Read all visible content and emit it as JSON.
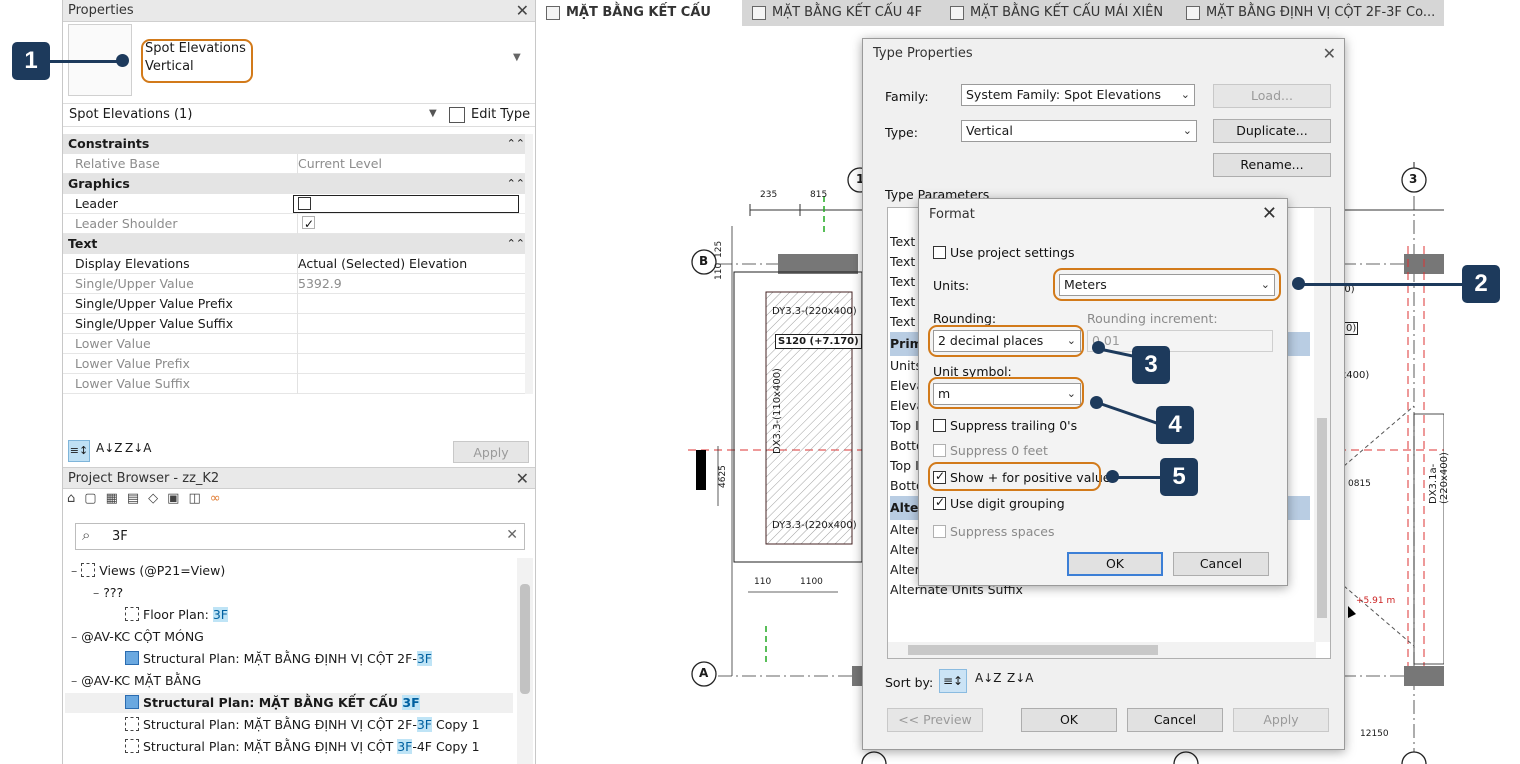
{
  "properties": {
    "title": "Properties",
    "type_name": "Spot Elevations",
    "type_sub": "Vertical",
    "selector": "Spot Elevations (1)",
    "edit_type": "Edit Type",
    "groups": {
      "constraints": "Constraints",
      "graphics": "Graphics",
      "text": "Text"
    },
    "rows": {
      "relative_base": {
        "k": "Relative Base",
        "v": "Current Level"
      },
      "leader": {
        "k": "Leader"
      },
      "leader_shoulder": {
        "k": "Leader Shoulder"
      },
      "display_elev": {
        "k": "Display Elevations",
        "v": "Actual (Selected) Elevation"
      },
      "upper_value": {
        "k": "Single/Upper Value",
        "v": "5392.9"
      },
      "upper_prefix": {
        "k": "Single/Upper Value Prefix"
      },
      "upper_suffix": {
        "k": "Single/Upper Value Suffix"
      },
      "lower_value": {
        "k": "Lower Value"
      },
      "lower_prefix": {
        "k": "Lower Value Prefix"
      },
      "lower_suffix": {
        "k": "Lower Value Suffix"
      }
    },
    "apply": "Apply"
  },
  "browser": {
    "title": "Project Browser - zz_K2",
    "search_value": "3F",
    "tree": {
      "views": "Views (@P21=View)",
      "q": "???",
      "floor_plan": "Floor Plan: ",
      "hl": "3F",
      "av_kc_cot": "@AV-KC CỘT MÓNG",
      "sp_dinhvi": "Structural Plan: MẶT BẰNG ĐỊNH VỊ CỘT 2F-",
      "av_kc_mb": "@AV-KC MẶT BẰNG",
      "sp_ketcau": "Structural Plan: MẶT BẰNG KẾT CẤU ",
      "sp_copy_pre": "Structural Plan: MẶT BẰNG ĐỊNH VỊ CỘT 2F-",
      "sp_copy_post": " Copy 1",
      "sp_34_pre": "Structural Plan: MẶT BẰNG ĐỊNH VỊ CỘT ",
      "sp_34_post": "-4F Copy 1"
    }
  },
  "tabs": [
    "MẶT BẰNG KẾT CẤU 3F",
    "MẶT BẰNG KẾT CẤU 4F",
    "MẶT BẰNG KẾT CẤU MÁI XIÊN",
    "MẶT BẰNG ĐỊNH VỊ CỘT 2F-3F Co..."
  ],
  "drawing": {
    "dim_235": "235",
    "dim_815": "815",
    "dim_125": "125",
    "dim_110": "110",
    "dy_top": "DY3.3-(220x400)",
    "dy_bot": "DY3.3-(220x400)",
    "spot": "S120 (+7.170)",
    "dx_vert": "DX3.3-(110x400)",
    "dim_4625": "4625",
    "dim_1100": "1100",
    "dim_110b": "110",
    "grid_b": "B",
    "grid_a": "A",
    "grid_3": "3",
    "grid_1": "1",
    "x400": "0x400)",
    "dx3a": "DX3.1a-(220x400)",
    "d0815": "0815",
    "spot2": "+5.91 m",
    "d12150": "12150",
    "d00": "00)",
    "d0b": "0)"
  },
  "type_props": {
    "title": "Type Properties",
    "family_label": "Family:",
    "family_value": "System Family: Spot Elevations",
    "type_label": "Type:",
    "type_value": "Vertical",
    "load": "Load...",
    "duplicate": "Duplicate...",
    "rename": "Rename...",
    "params_label": "Type Parameters",
    "rows": [
      "Text",
      "Text",
      "Text",
      "Text",
      "Text",
      "Prim",
      "Units",
      "Eleva",
      "Eleva",
      "Top I",
      "Botto",
      "Top I",
      "Botto",
      "Alter",
      "Alter",
      "Alter",
      "Alter",
      "Alternate Units Suffix"
    ],
    "sort_label": "Sort by:",
    "preview": "<< Preview",
    "ok": "OK",
    "cancel": "Cancel",
    "apply": "Apply"
  },
  "format": {
    "title": "Format",
    "use_project": "Use project settings",
    "units_label": "Units:",
    "units_value": "Meters",
    "rounding_label": "Rounding:",
    "rounding_value": "2 decimal places",
    "rounding_inc_label": "Rounding increment:",
    "rounding_inc_value": "0.01",
    "unit_symbol_label": "Unit symbol:",
    "unit_symbol_value": "m",
    "suppress_trailing": "Suppress trailing 0's",
    "suppress_feet": "Suppress 0 feet",
    "show_plus": "Show + for positive values",
    "digit_grouping": "Use digit grouping",
    "suppress_spaces": "Suppress spaces",
    "ok": "OK",
    "cancel": "Cancel"
  },
  "callouts": [
    "1",
    "2",
    "3",
    "4",
    "5"
  ],
  "colors": {
    "callout": "#1d3a5c",
    "ring": "#d27a1a",
    "highlight": "#bfe4f6"
  }
}
